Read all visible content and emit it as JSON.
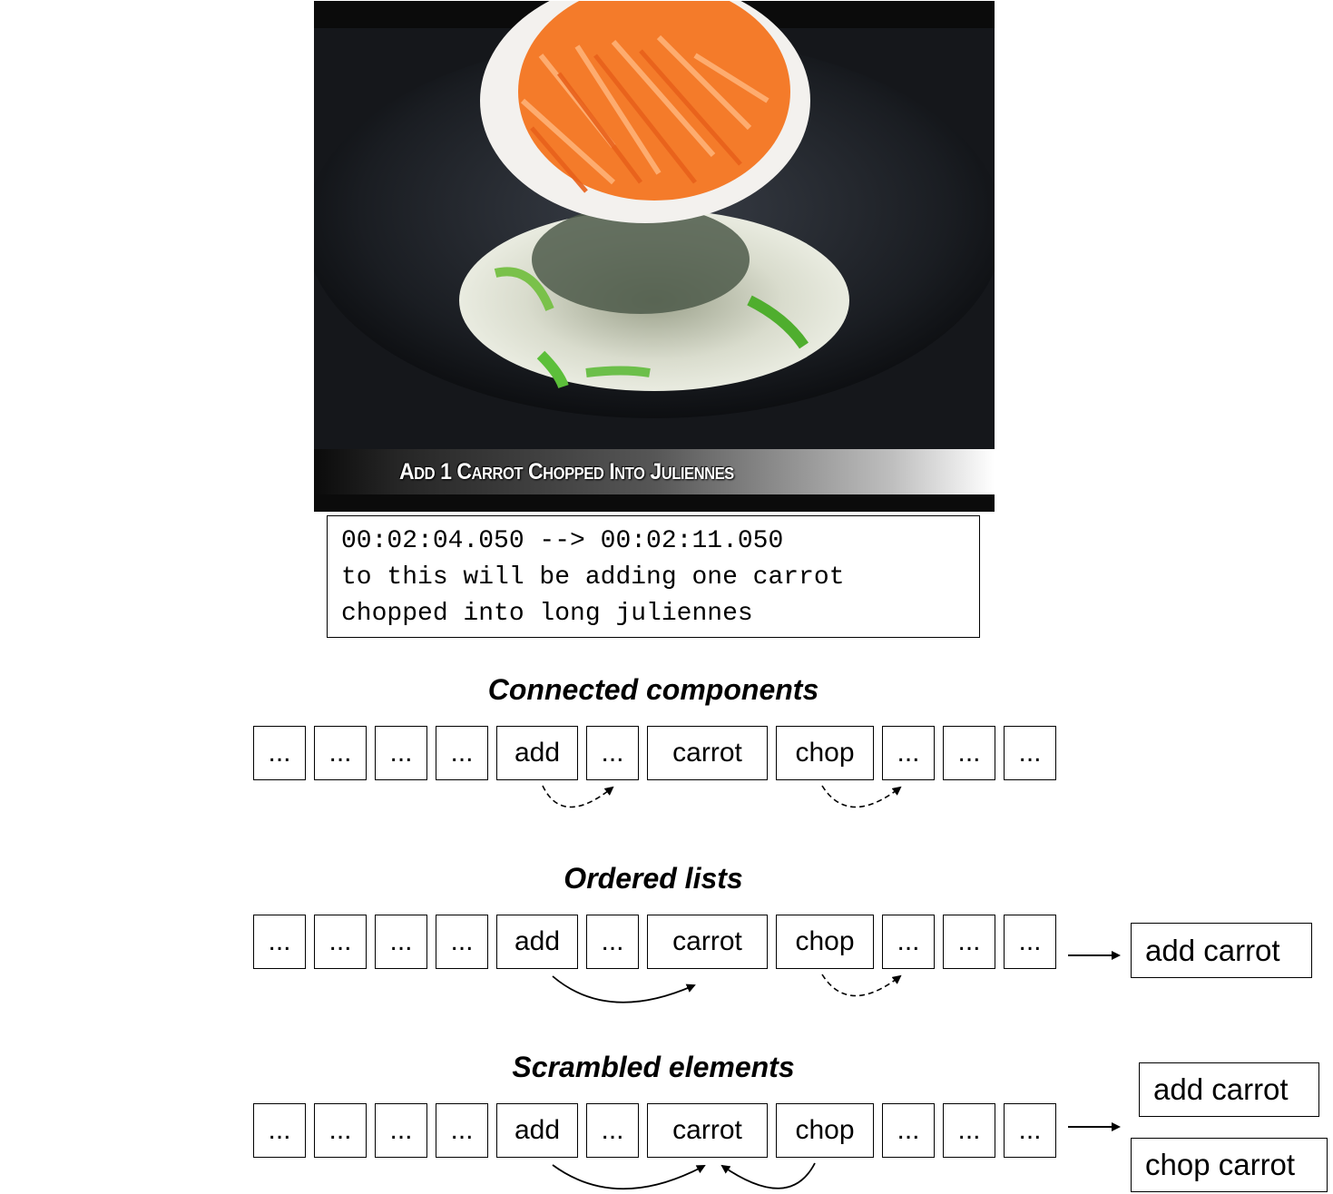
{
  "video": {
    "overlay_caption": "Add 1 Carrot Chopped Into Juliennes"
  },
  "subtitle": {
    "lines": [
      "00:02:04.050 --> 00:02:11.050",
      "to this will be adding one carrot",
      "chopped into long juliennes"
    ]
  },
  "rows": [
    {
      "title": "Connected components",
      "tokens": [
        "...",
        "...",
        "...",
        "...",
        "add",
        "...",
        "carrot",
        "chop",
        "...",
        "...",
        "..."
      ],
      "outputs": []
    },
    {
      "title": "Ordered lists",
      "tokens": [
        "...",
        "...",
        "...",
        "...",
        "add",
        "...",
        "carrot",
        "chop",
        "...",
        "...",
        "..."
      ],
      "outputs": [
        "add carrot"
      ]
    },
    {
      "title": "Scrambled elements",
      "tokens": [
        "...",
        "...",
        "...",
        "...",
        "add",
        "...",
        "carrot",
        "chop",
        "...",
        "...",
        "..."
      ],
      "outputs": [
        "add carrot",
        "chop carrot"
      ]
    }
  ]
}
